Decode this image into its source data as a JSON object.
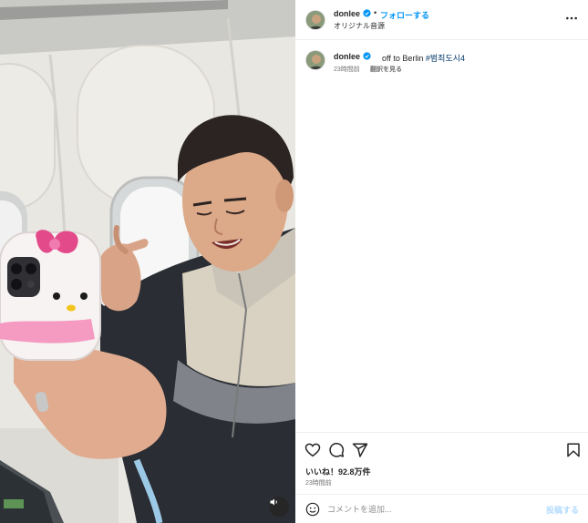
{
  "post": {
    "username": "donlee",
    "verified": true,
    "separator": "•",
    "follow_label": "フォローする",
    "audio_label": "オリジナル音源",
    "more_icon": "more-horizontal-icon"
  },
  "caption": {
    "username": "donlee",
    "text": "off to Berlin ",
    "hashtag": "#범죄도시4",
    "time": "23時間前",
    "translate_label": "翻訳を見る"
  },
  "actions": {
    "icons": [
      "heart-icon",
      "comment-icon",
      "share-icon",
      "bookmark-icon"
    ],
    "likes": "いいね！92.8万件",
    "time": "23時間前"
  },
  "comment": {
    "placeholder": "コメントを追加...",
    "post_label": "投稿する"
  },
  "colors": {
    "accent": "#0095f6",
    "hashtag": "#00376b",
    "post_disabled": "#b3dbff",
    "muted": "#737373"
  }
}
